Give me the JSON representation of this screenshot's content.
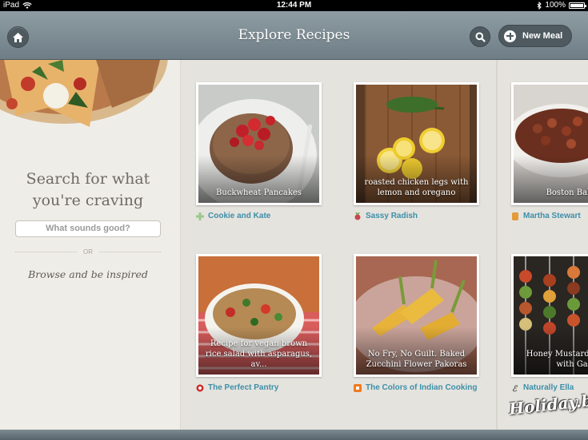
{
  "status_bar": {
    "device": "iPad",
    "time": "12:44 PM",
    "battery": "100%"
  },
  "nav": {
    "title": "Explore Recipes",
    "new_meal_label": "New Meal"
  },
  "sidebar": {
    "heading": "Search for what you're craving",
    "search_placeholder": "What sounds good?",
    "or_label": "OR",
    "browse_label": "Browse and be inspired"
  },
  "recipes": [
    {
      "caption": "Buckwheat Pancakes",
      "source": "Cookie and Kate",
      "source_color": "#9bc98a"
    },
    {
      "caption": "roasted chicken legs with lemon and oregano",
      "source": "Sassy Radish",
      "source_color": "#c9464f"
    },
    {
      "caption": "Boston Baked",
      "source": "Martha Stewart",
      "source_color": "#e29a3a"
    },
    {
      "caption": "Recipe for vegan brown rice salad with asparagus, av...",
      "source": "The Perfect Pantry",
      "source_color": "#cc2b2b"
    },
    {
      "caption": "No Fry, No Guilt. Baked Zucchini Flower Pakoras",
      "source": "The Colors of Indian Cooking",
      "source_color": "#f07a1d"
    },
    {
      "caption": "Honey Mustard Kabobs with Gar",
      "source": "Naturally Ella",
      "source_color": "#555555"
    }
  ],
  "watermark": "Holiday.by",
  "colors": {
    "nav_bar": "#7f8e95",
    "source_link": "#3c8fa8",
    "panel_bg": "#efede8"
  }
}
